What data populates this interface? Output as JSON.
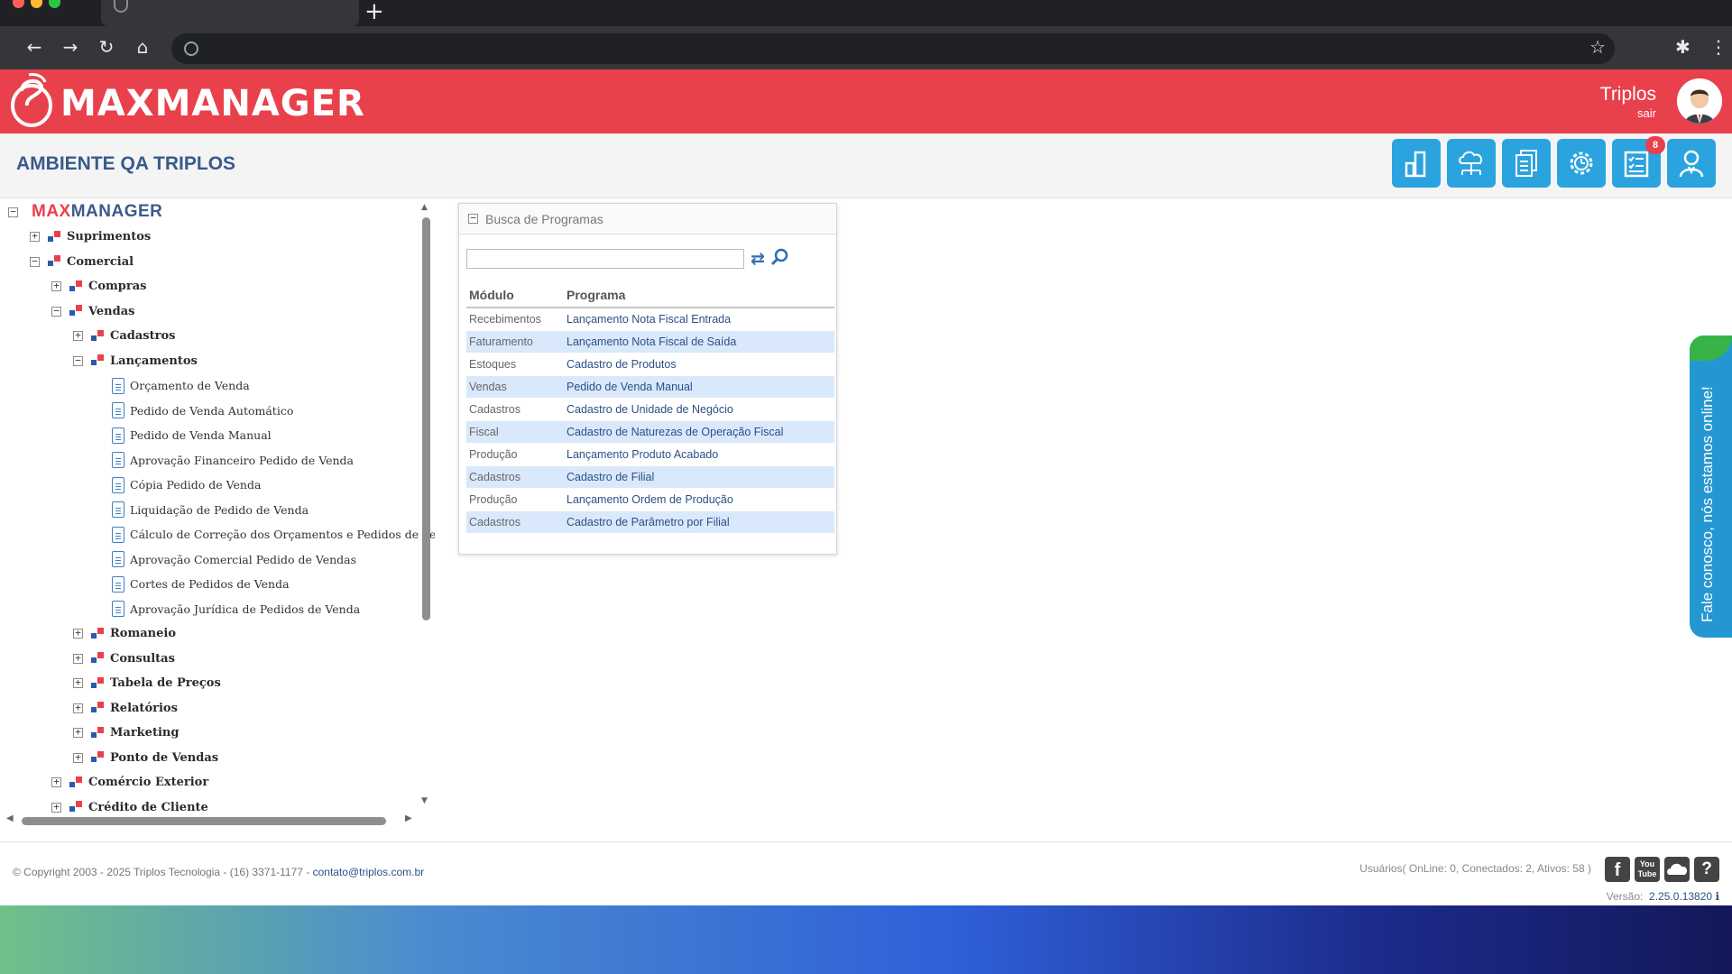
{
  "browser": {
    "new_tab_glyph": "+",
    "back_icon": "arrow-left",
    "forward_icon": "arrow-right",
    "reload_icon": "reload",
    "home_icon": "home"
  },
  "header": {
    "brand": "MAXMANAGER",
    "user_name": "Triplos",
    "logout": "sair",
    "brand_color": "#e8414c"
  },
  "subheader": {
    "environment": "AMBIENTE QA TRIPLOS",
    "notification_count": "8",
    "tool_icons": [
      "chart-icon",
      "cloud-network-icon",
      "documents-icon",
      "settings-icon",
      "checklist-icon",
      "user-support-icon"
    ]
  },
  "tree": {
    "root_a": "MAX",
    "root_b": "MANAGER",
    "items": [
      {
        "label": "Suprimentos",
        "type": "folder",
        "state": "+"
      },
      {
        "label": "Comercial",
        "type": "folder",
        "state": "−"
      },
      {
        "label": "Compras",
        "type": "folder",
        "state": "+"
      },
      {
        "label": "Vendas",
        "type": "folder",
        "state": "−"
      },
      {
        "label": "Cadastros",
        "type": "folder",
        "state": "+"
      },
      {
        "label": "Lançamentos",
        "type": "folder",
        "state": "−"
      },
      {
        "label": "Orçamento de Venda",
        "type": "doc"
      },
      {
        "label": "Pedido de Venda Automático",
        "type": "doc"
      },
      {
        "label": "Pedido de Venda Manual",
        "type": "doc"
      },
      {
        "label": "Aprovação Financeiro Pedido de Venda",
        "type": "doc"
      },
      {
        "label": "Cópia Pedido de Venda",
        "type": "doc"
      },
      {
        "label": "Liquidação de Pedido de Venda",
        "type": "doc"
      },
      {
        "label": "Cálculo de Correção dos Orçamentos e Pedidos de Venda",
        "type": "doc"
      },
      {
        "label": "Aprovação Comercial Pedido de Vendas",
        "type": "doc"
      },
      {
        "label": "Cortes de Pedidos de Venda",
        "type": "doc"
      },
      {
        "label": "Aprovação Jurídica de Pedidos de Venda",
        "type": "doc"
      },
      {
        "label": "Romaneio",
        "type": "folder",
        "state": "+"
      },
      {
        "label": "Consultas",
        "type": "folder",
        "state": "+"
      },
      {
        "label": "Tabela de Preços",
        "type": "folder",
        "state": "+"
      },
      {
        "label": "Relatórios",
        "type": "folder",
        "state": "+"
      },
      {
        "label": "Marketing",
        "type": "folder",
        "state": "+"
      },
      {
        "label": "Ponto de Vendas",
        "type": "folder",
        "state": "+"
      },
      {
        "label": "Comércio Exterior",
        "type": "folder",
        "state": "+"
      },
      {
        "label": "Crédito de Cliente",
        "type": "folder",
        "state": "+"
      }
    ]
  },
  "search": {
    "title": "Busca de Programas",
    "input_value": "",
    "col_module": "Módulo",
    "col_program": "Programa",
    "rows": [
      {
        "module": "Recebimentos",
        "program": "Lançamento Nota Fiscal Entrada"
      },
      {
        "module": "Faturamento",
        "program": "Lançamento Nota Fiscal de Saída"
      },
      {
        "module": "Estoques",
        "program": "Cadastro de Produtos"
      },
      {
        "module": "Vendas",
        "program": "Pedido de Venda Manual"
      },
      {
        "module": "Cadastros",
        "program": "Cadastro de Unidade de Negócio"
      },
      {
        "module": "Fiscal",
        "program": "Cadastro de Naturezas de Operação Fiscal"
      },
      {
        "module": "Produção",
        "program": "Lançamento Produto Acabado"
      },
      {
        "module": "Cadastros",
        "program": "Cadastro de Filial"
      },
      {
        "module": "Produção",
        "program": "Lançamento Ordem de Produção"
      },
      {
        "module": "Cadastros",
        "program": "Cadastro de Parâmetro por Filial"
      }
    ]
  },
  "chat": {
    "label": "Fale conosco, nós estamos online!"
  },
  "footer": {
    "copyright": "© Copyright 2003 - 2025 Triplos Tecnologia - (16) 3371-1177 - ",
    "email": "contato@triplos.com.br",
    "users": "Usuários( OnLine: 0, Conectados: 2, Ativos: 58 )",
    "version_label": "Versão:",
    "version_value": "2.25.0.13820",
    "social_icons": [
      "facebook-icon",
      "youtube-icon",
      "cloud-icon",
      "help-icon"
    ]
  }
}
